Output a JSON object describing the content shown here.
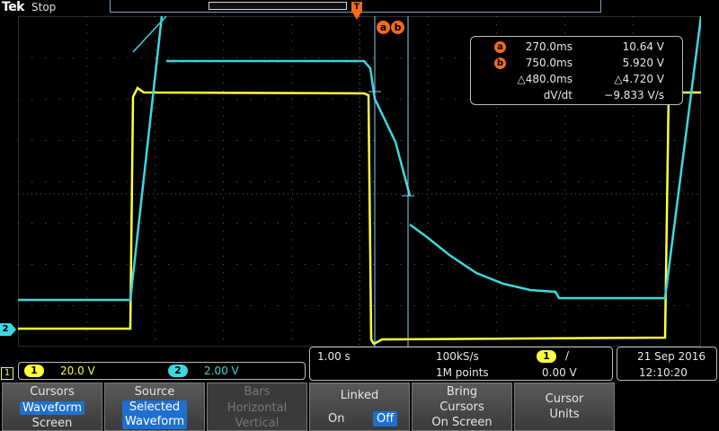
{
  "header": {
    "brand": "Tek",
    "run_state": "Stop"
  },
  "trigger_marker": "T",
  "cursor_markers": {
    "a": "a",
    "b": "b"
  },
  "channel_markers": {
    "ch1": "1",
    "ch2": "2"
  },
  "readout": {
    "a_label": "a",
    "b_label": "b",
    "a_time": "270.0ms",
    "a_volt": "10.64 V",
    "b_time": "750.0ms",
    "b_volt": "5.920 V",
    "delta_time": "△480.0ms",
    "delta_volt": "△4.720 V",
    "dvdt_label": "dV/dt",
    "dvdt_value": "−9.833 V/s"
  },
  "channels": {
    "ch1": {
      "num": "1",
      "scale": "20.0 V",
      "color": "#ffff3c"
    },
    "ch2": {
      "num": "2",
      "scale": "2.00 V",
      "color": "#3cd8e0"
    }
  },
  "horizontal": {
    "timebase": "1.00 s",
    "sample_rate": "100kS/s",
    "record_length": "1M points"
  },
  "trigger": {
    "source": "1",
    "slope": "/",
    "level": "0.00 V"
  },
  "datetime": {
    "date": "21 Sep 2016",
    "time": "12:10:20"
  },
  "menu": {
    "cursors": {
      "title": "Cursors",
      "selected": "Waveform",
      "other": "Screen"
    },
    "source": {
      "title": "Source",
      "line1": "Selected",
      "line2": "Waveform"
    },
    "bars": {
      "title": "Bars",
      "line1": "Horizontal",
      "line2": "Vertical"
    },
    "linked": {
      "title": "Linked",
      "on": "On",
      "off": "Off"
    },
    "bring": {
      "line1": "Bring",
      "line2": "Cursors",
      "line3": "On Screen"
    },
    "units": {
      "line1": "Cursor",
      "line2": "Units"
    }
  }
}
